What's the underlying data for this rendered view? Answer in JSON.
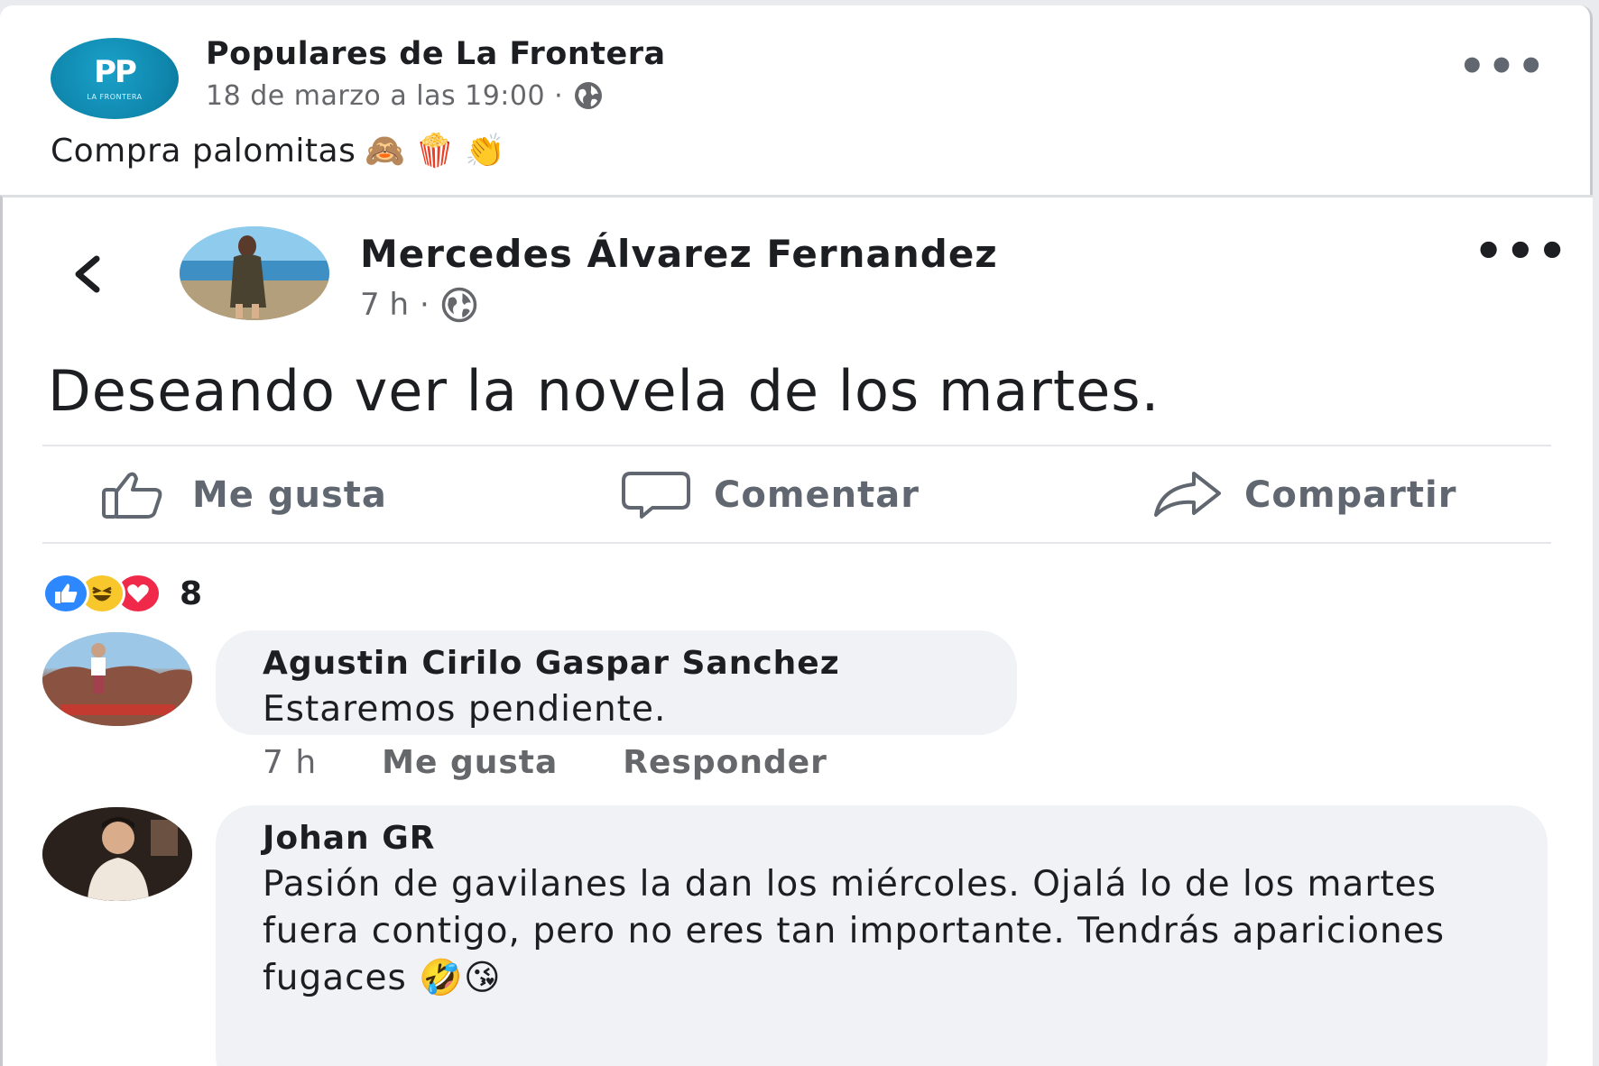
{
  "outer_post": {
    "page_name": "Populares de La Frontera",
    "avatar_logo": "PP",
    "avatar_subtitle": "LA FRONTERA",
    "timestamp": "18 de marzo a las 19:00",
    "separator": "·",
    "audience_icon": "globe-icon",
    "caption": "Compra palomitas",
    "caption_emojis": [
      "🙈",
      "🍿",
      "👏"
    ]
  },
  "inner_post": {
    "author_name": "Mercedes Álvarez Fernandez",
    "time": "7 h",
    "separator": "·",
    "audience_icon": "globe-icon",
    "status_text": "Deseando ver la novela de los martes.",
    "actions": {
      "like": "Me gusta",
      "comment": "Comentar",
      "share": "Compartir"
    },
    "reactions": {
      "types": [
        "like",
        "haha",
        "love"
      ],
      "count": "8"
    },
    "comments": [
      {
        "author": "Agustin Cirilo Gaspar Sanchez",
        "text": "Estaremos pendiente.",
        "time": "7 h",
        "like_label": "Me gusta",
        "reply_label": "Responder"
      },
      {
        "author": "Johan GR",
        "text": "Pasión de gavilanes la dan los miércoles. Ojalá lo de los martes fuera contigo, pero no eres tan importante. Tendrás apariciones fugaces 🤣😘"
      }
    ]
  },
  "colors": {
    "pp_blue": "#0f85ab",
    "fb_blue": "#2d88ff",
    "secondary_text": "#65676b",
    "bubble_bg": "#f0f2f5"
  }
}
